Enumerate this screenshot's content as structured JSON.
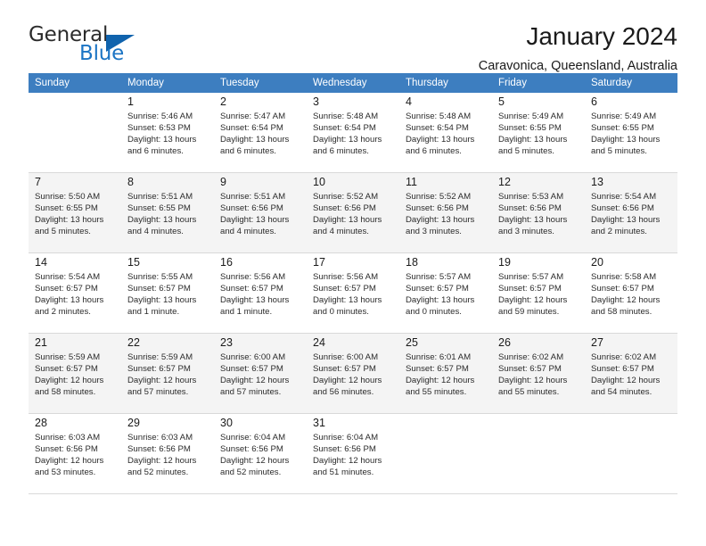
{
  "brand": {
    "name_part1": "General",
    "name_part2": "Blue",
    "accent_color": "#1b74c4",
    "triangle_color": "#1063ad"
  },
  "header": {
    "title": "January 2024",
    "subtitle": "Caravonica, Queensland, Australia"
  },
  "calendar": {
    "header_bg": "#3d7ec0",
    "weekdays": [
      "Sunday",
      "Monday",
      "Tuesday",
      "Wednesday",
      "Thursday",
      "Friday",
      "Saturday"
    ],
    "weeks": [
      [
        {
          "day": "",
          "sunrise": "",
          "sunset": "",
          "daylight1": "",
          "daylight2": ""
        },
        {
          "day": "1",
          "sunrise": "Sunrise: 5:46 AM",
          "sunset": "Sunset: 6:53 PM",
          "daylight1": "Daylight: 13 hours",
          "daylight2": "and 6 minutes."
        },
        {
          "day": "2",
          "sunrise": "Sunrise: 5:47 AM",
          "sunset": "Sunset: 6:54 PM",
          "daylight1": "Daylight: 13 hours",
          "daylight2": "and 6 minutes."
        },
        {
          "day": "3",
          "sunrise": "Sunrise: 5:48 AM",
          "sunset": "Sunset: 6:54 PM",
          "daylight1": "Daylight: 13 hours",
          "daylight2": "and 6 minutes."
        },
        {
          "day": "4",
          "sunrise": "Sunrise: 5:48 AM",
          "sunset": "Sunset: 6:54 PM",
          "daylight1": "Daylight: 13 hours",
          "daylight2": "and 6 minutes."
        },
        {
          "day": "5",
          "sunrise": "Sunrise: 5:49 AM",
          "sunset": "Sunset: 6:55 PM",
          "daylight1": "Daylight: 13 hours",
          "daylight2": "and 5 minutes."
        },
        {
          "day": "6",
          "sunrise": "Sunrise: 5:49 AM",
          "sunset": "Sunset: 6:55 PM",
          "daylight1": "Daylight: 13 hours",
          "daylight2": "and 5 minutes."
        }
      ],
      [
        {
          "day": "7",
          "sunrise": "Sunrise: 5:50 AM",
          "sunset": "Sunset: 6:55 PM",
          "daylight1": "Daylight: 13 hours",
          "daylight2": "and 5 minutes."
        },
        {
          "day": "8",
          "sunrise": "Sunrise: 5:51 AM",
          "sunset": "Sunset: 6:55 PM",
          "daylight1": "Daylight: 13 hours",
          "daylight2": "and 4 minutes."
        },
        {
          "day": "9",
          "sunrise": "Sunrise: 5:51 AM",
          "sunset": "Sunset: 6:56 PM",
          "daylight1": "Daylight: 13 hours",
          "daylight2": "and 4 minutes."
        },
        {
          "day": "10",
          "sunrise": "Sunrise: 5:52 AM",
          "sunset": "Sunset: 6:56 PM",
          "daylight1": "Daylight: 13 hours",
          "daylight2": "and 4 minutes."
        },
        {
          "day": "11",
          "sunrise": "Sunrise: 5:52 AM",
          "sunset": "Sunset: 6:56 PM",
          "daylight1": "Daylight: 13 hours",
          "daylight2": "and 3 minutes."
        },
        {
          "day": "12",
          "sunrise": "Sunrise: 5:53 AM",
          "sunset": "Sunset: 6:56 PM",
          "daylight1": "Daylight: 13 hours",
          "daylight2": "and 3 minutes."
        },
        {
          "day": "13",
          "sunrise": "Sunrise: 5:54 AM",
          "sunset": "Sunset: 6:56 PM",
          "daylight1": "Daylight: 13 hours",
          "daylight2": "and 2 minutes."
        }
      ],
      [
        {
          "day": "14",
          "sunrise": "Sunrise: 5:54 AM",
          "sunset": "Sunset: 6:57 PM",
          "daylight1": "Daylight: 13 hours",
          "daylight2": "and 2 minutes."
        },
        {
          "day": "15",
          "sunrise": "Sunrise: 5:55 AM",
          "sunset": "Sunset: 6:57 PM",
          "daylight1": "Daylight: 13 hours",
          "daylight2": "and 1 minute."
        },
        {
          "day": "16",
          "sunrise": "Sunrise: 5:56 AM",
          "sunset": "Sunset: 6:57 PM",
          "daylight1": "Daylight: 13 hours",
          "daylight2": "and 1 minute."
        },
        {
          "day": "17",
          "sunrise": "Sunrise: 5:56 AM",
          "sunset": "Sunset: 6:57 PM",
          "daylight1": "Daylight: 13 hours",
          "daylight2": "and 0 minutes."
        },
        {
          "day": "18",
          "sunrise": "Sunrise: 5:57 AM",
          "sunset": "Sunset: 6:57 PM",
          "daylight1": "Daylight: 13 hours",
          "daylight2": "and 0 minutes."
        },
        {
          "day": "19",
          "sunrise": "Sunrise: 5:57 AM",
          "sunset": "Sunset: 6:57 PM",
          "daylight1": "Daylight: 12 hours",
          "daylight2": "and 59 minutes."
        },
        {
          "day": "20",
          "sunrise": "Sunrise: 5:58 AM",
          "sunset": "Sunset: 6:57 PM",
          "daylight1": "Daylight: 12 hours",
          "daylight2": "and 58 minutes."
        }
      ],
      [
        {
          "day": "21",
          "sunrise": "Sunrise: 5:59 AM",
          "sunset": "Sunset: 6:57 PM",
          "daylight1": "Daylight: 12 hours",
          "daylight2": "and 58 minutes."
        },
        {
          "day": "22",
          "sunrise": "Sunrise: 5:59 AM",
          "sunset": "Sunset: 6:57 PM",
          "daylight1": "Daylight: 12 hours",
          "daylight2": "and 57 minutes."
        },
        {
          "day": "23",
          "sunrise": "Sunrise: 6:00 AM",
          "sunset": "Sunset: 6:57 PM",
          "daylight1": "Daylight: 12 hours",
          "daylight2": "and 57 minutes."
        },
        {
          "day": "24",
          "sunrise": "Sunrise: 6:00 AM",
          "sunset": "Sunset: 6:57 PM",
          "daylight1": "Daylight: 12 hours",
          "daylight2": "and 56 minutes."
        },
        {
          "day": "25",
          "sunrise": "Sunrise: 6:01 AM",
          "sunset": "Sunset: 6:57 PM",
          "daylight1": "Daylight: 12 hours",
          "daylight2": "and 55 minutes."
        },
        {
          "day": "26",
          "sunrise": "Sunrise: 6:02 AM",
          "sunset": "Sunset: 6:57 PM",
          "daylight1": "Daylight: 12 hours",
          "daylight2": "and 55 minutes."
        },
        {
          "day": "27",
          "sunrise": "Sunrise: 6:02 AM",
          "sunset": "Sunset: 6:57 PM",
          "daylight1": "Daylight: 12 hours",
          "daylight2": "and 54 minutes."
        }
      ],
      [
        {
          "day": "28",
          "sunrise": "Sunrise: 6:03 AM",
          "sunset": "Sunset: 6:56 PM",
          "daylight1": "Daylight: 12 hours",
          "daylight2": "and 53 minutes."
        },
        {
          "day": "29",
          "sunrise": "Sunrise: 6:03 AM",
          "sunset": "Sunset: 6:56 PM",
          "daylight1": "Daylight: 12 hours",
          "daylight2": "and 52 minutes."
        },
        {
          "day": "30",
          "sunrise": "Sunrise: 6:04 AM",
          "sunset": "Sunset: 6:56 PM",
          "daylight1": "Daylight: 12 hours",
          "daylight2": "and 52 minutes."
        },
        {
          "day": "31",
          "sunrise": "Sunrise: 6:04 AM",
          "sunset": "Sunset: 6:56 PM",
          "daylight1": "Daylight: 12 hours",
          "daylight2": "and 51 minutes."
        },
        {
          "day": "",
          "sunrise": "",
          "sunset": "",
          "daylight1": "",
          "daylight2": ""
        },
        {
          "day": "",
          "sunrise": "",
          "sunset": "",
          "daylight1": "",
          "daylight2": ""
        },
        {
          "day": "",
          "sunrise": "",
          "sunset": "",
          "daylight1": "",
          "daylight2": ""
        }
      ]
    ]
  }
}
